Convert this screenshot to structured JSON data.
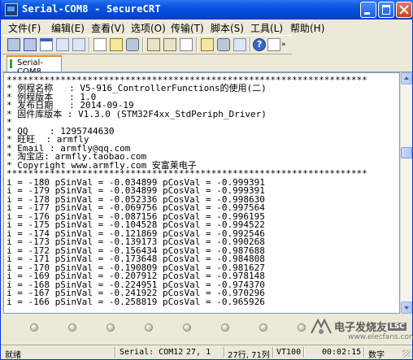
{
  "window": {
    "title": "Serial-COM8 - SecureCRT"
  },
  "menu": [
    "文件(F)",
    "编辑(E)",
    "查看(V)",
    "选项(O)",
    "传输(T)",
    "脚本(S)",
    "工具(L)",
    "帮助(H)"
  ],
  "toolbar": {
    "icons": [
      "connect-icon",
      "quick-connect-icon",
      "connect-in-tab-icon",
      "reconnect-icon",
      "disconnect-icon",
      "copy-icon",
      "paste-icon",
      "find-icon",
      "print-icon",
      "print-screen-icon",
      "session-options-icon",
      "keymap-icon",
      "sftp-icon",
      "help-icon",
      "log-icon"
    ],
    "more": "»"
  },
  "tab": {
    "label": "Serial-COM8"
  },
  "terminal": {
    "lines": [
      "*******************************************************************",
      "* 例程名称   : V5-916_ControllerFunctions的使用(二)",
      "* 例程版本   : 1.0",
      "* 发布日期   : 2014-09-19",
      "* 固件库版本 : V1.3.0 (STM32F4xx_StdPeriph_Driver)",
      "*",
      "* QQ    : 1295744630",
      "* 旺旺  : armfly",
      "* Email : armfly@qq.com",
      "* 淘宝店: armfly.taobao.com",
      "* Copyright www.armfly.com 安富莱电子",
      "*******************************************************************",
      "i = -180 pSinVal = -0.034899 pCosVal = -0.999391",
      "i = -179 pSinVal = -0.034899 pCosVal = -0.999391",
      "i = -178 pSinVal = -0.052336 pCosVal = -0.998630",
      "i = -177 pSinVal = -0.069756 pCosVal = -0.997564",
      "i = -176 pSinVal = -0.087156 pCosVal = -0.996195",
      "i = -175 pSinVal = -0.104528 pCosVal = -0.994522",
      "i = -174 pSinVal = -0.121869 pCosVal = -0.992546",
      "i = -173 pSinVal = -0.139173 pCosVal = -0.990268",
      "i = -172 pSinVal = -0.156434 pCosVal = -0.987688",
      "i = -171 pSinVal = -0.173648 pCosVal = -0.984808",
      "i = -170 pSinVal = -0.190809 pCosVal = -0.981627",
      "i = -169 pSinVal = -0.207912 pCosVal = -0.978148",
      "i = -168 pSinVal = -0.224951 pCosVal = -0.974370",
      "i = -167 pSinVal = -0.241922 pCosVal = -0.970296",
      "i = -166 pSinVal = -0.258819 pCosVal = -0.965926"
    ]
  },
  "watermark": {
    "text": "电子发烧友",
    "url": "www.elecfans.com",
    "badge": "LSC"
  },
  "status": {
    "ready": "就绪",
    "port": "Serial: COM12",
    "row_col": "27,  1",
    "size": "27行, 71列",
    "emulation": "VT100",
    "time": "00:02:15",
    "mode": "数字"
  },
  "colors": {
    "titlebar": "#0a58e4",
    "terminal_bg": "#ffffff",
    "window_bg": "#ece9d8"
  }
}
